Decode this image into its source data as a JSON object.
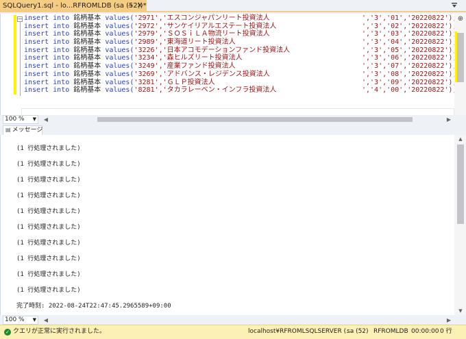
{
  "tab": {
    "title": "SQLQuery1.sql - lo...RFROMLDB (sa (52))*",
    "pin_icon": "pin-icon",
    "close_icon": "close-icon"
  },
  "editor": {
    "lines": [
      {
        "k1": "insert",
        "k2": "into",
        "table": "銘柄基本",
        "k3": "values(",
        "str": "'2971','エスコンジャパンリート投資法人",
        "tail": "','3','01','20220822');"
      },
      {
        "k1": "insert",
        "k2": "into",
        "table": "銘柄基本",
        "k3": "values(",
        "str": "'2972','サンケイリアルエステート投資法人",
        "tail": "','3','02','20220822');"
      },
      {
        "k1": "insert",
        "k2": "into",
        "table": "銘柄基本",
        "k3": "values(",
        "str": "'2979','ＳＯＳｉＬＡ物流リート投資法人",
        "tail": "','3','03','20220822');"
      },
      {
        "k1": "insert",
        "k2": "into",
        "table": "銘柄基本",
        "k3": "values(",
        "str": "'2989','東海道リート投資法人",
        "tail": "','3','04','20220822');"
      },
      {
        "k1": "insert",
        "k2": "into",
        "table": "銘柄基本",
        "k3": "values(",
        "str": "'3226','日本アコモデーションファンド投資法人",
        "tail": "','3','05','20220822');"
      },
      {
        "k1": "insert",
        "k2": "into",
        "table": "銘柄基本",
        "k3": "values(",
        "str": "'3234','森ヒルズリート投資法人",
        "tail": "','3','06','20220822');"
      },
      {
        "k1": "insert",
        "k2": "into",
        "table": "銘柄基本",
        "k3": "values(",
        "str": "'3249','産業ファンド投資法人",
        "tail": "','3','07','20220822');"
      },
      {
        "k1": "insert",
        "k2": "into",
        "table": "銘柄基本",
        "k3": "values(",
        "str": "'3269','アドバンス・レジデンス投資法人",
        "tail": "','3','08','20220822');"
      },
      {
        "k1": "insert",
        "k2": "into",
        "table": "銘柄基本",
        "k3": "values(",
        "str": "'3281','ＧＬＰ投資法人",
        "tail": "','3','09','20220822');"
      },
      {
        "k1": "insert",
        "k2": "into",
        "table": "銘柄基本",
        "k3": "values(",
        "str": "'8281','タカラレーベン・インフラ投資法人",
        "tail": "','4','00','20220822');"
      }
    ],
    "zoom": "100 %"
  },
  "results": {
    "tab_label": "メッセージ",
    "messages": [
      "(1 行処理されました)",
      "(1 行処理されました)",
      "(1 行処理されました)",
      "(1 行処理されました)",
      "(1 行処理されました)",
      "(1 行処理されました)",
      "(1 行処理されました)",
      "(1 行処理されました)",
      "(1 行処理されました)",
      "(1 行処理されました)"
    ],
    "completion": "完了時刻: 2022-08-24T22:47:45.2965589+09:00",
    "zoom": "100 %"
  },
  "status": {
    "message": "クエリが正常に実行されました。",
    "server": "localhost¥RFROMLSQLSERVER (...",
    "user": "sa (52)",
    "database": "RFROMLDB",
    "elapsed": "00:00:00",
    "rows": "0 行"
  },
  "colors": {
    "tab_active": "#f5cc84",
    "status_bar": "#fdf0b4",
    "keyword": "#2a3fc7",
    "string": "#a31515",
    "change_marker": "#fff200"
  }
}
